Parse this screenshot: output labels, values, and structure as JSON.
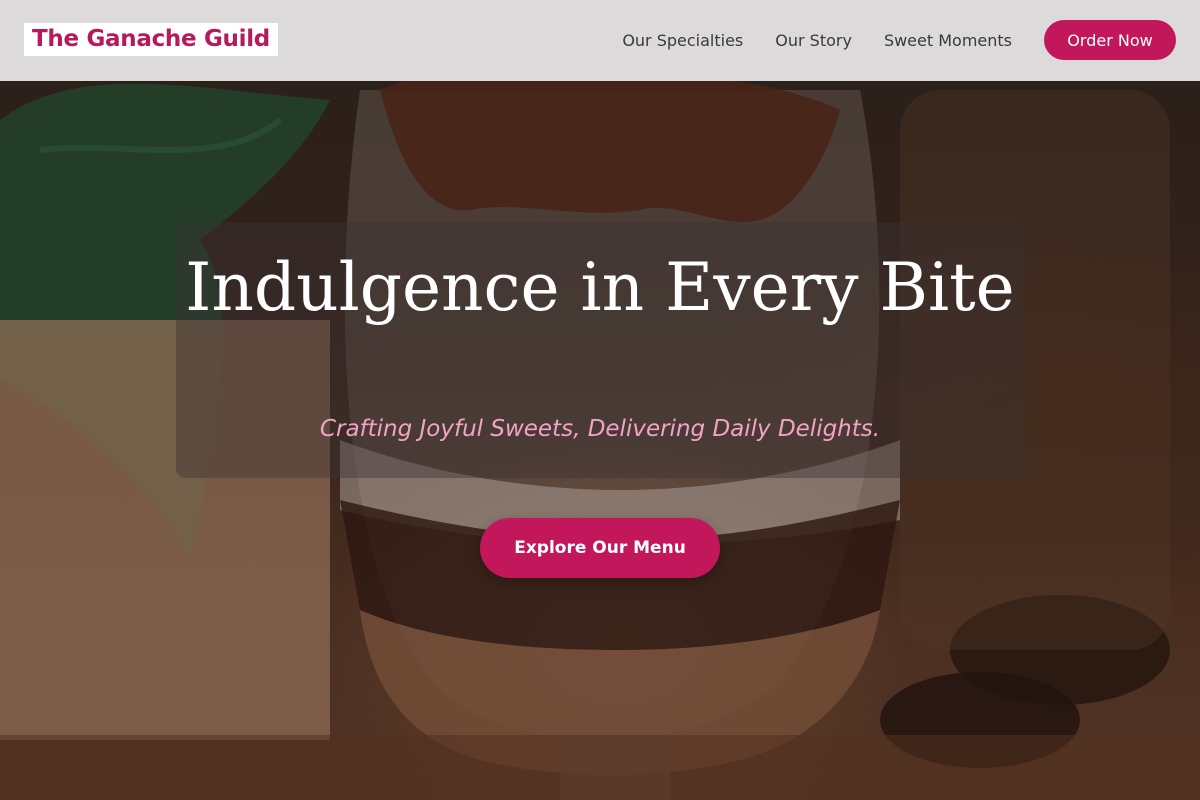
{
  "header": {
    "brand": "The Ganache Guild",
    "nav": [
      {
        "label": "Our Specialties"
      },
      {
        "label": "Our Story"
      },
      {
        "label": "Sweet Moments"
      }
    ],
    "cta_label": "Order Now"
  },
  "hero": {
    "title": "Indulgence in Every Bite",
    "tagline": "Crafting Joyful Sweets, Delivering Daily Delights.",
    "button_label": "Explore Our Menu"
  },
  "colors": {
    "accent": "#c2185b",
    "brand_text": "#b51a5b",
    "tagline": "#f2a3c4"
  }
}
